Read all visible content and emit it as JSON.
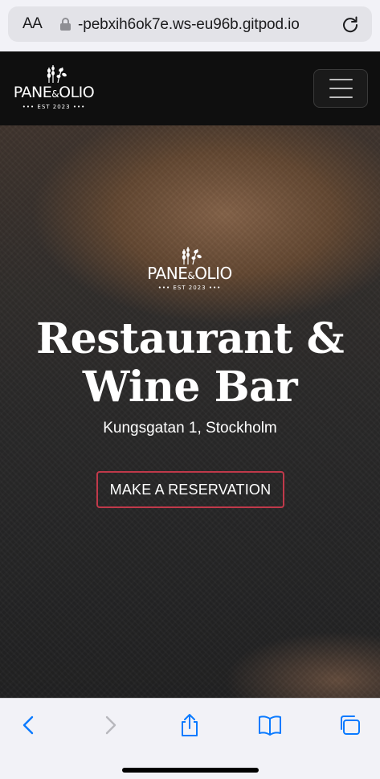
{
  "browser": {
    "text_size_label": "AA",
    "url": "-pebxih6ok7e.ws-eu96b.gitpod.io",
    "accent_color": "#0a7aff",
    "icons": [
      "lock-icon",
      "reload-icon",
      "back-icon",
      "forward-icon",
      "share-icon",
      "bookmarks-icon",
      "tabs-icon"
    ]
  },
  "brand": {
    "name_left": "PANE",
    "ampersand": "&",
    "name_right": "OLIO",
    "established": "••• EST 2023 •••"
  },
  "hero": {
    "title_line1": "Restaurant &",
    "title_line2": "Wine Bar",
    "address": "Kungsgatan 1, Stockholm",
    "cta_label": "MAKE A RESERVATION",
    "cta_border_color": "#c0394a"
  }
}
